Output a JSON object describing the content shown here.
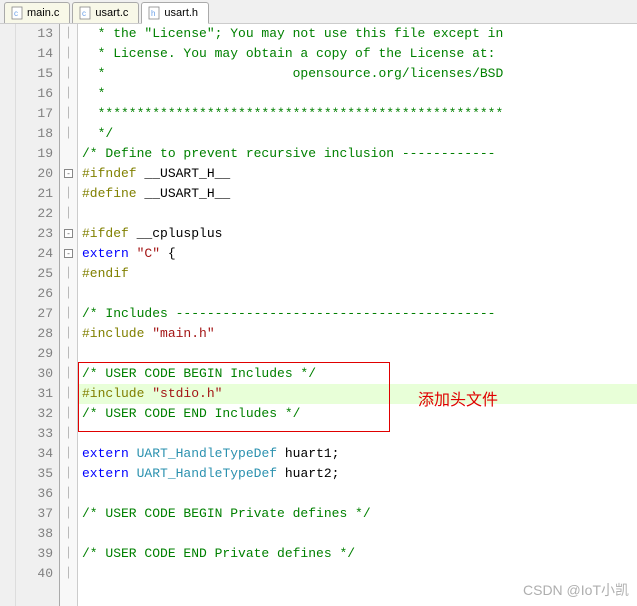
{
  "tabs": [
    {
      "label": "main.c",
      "active": false
    },
    {
      "label": "usart.c",
      "active": false
    },
    {
      "label": "usart.h",
      "active": true
    }
  ],
  "gutter_start": 13,
  "code_lines": [
    {
      "n": 13,
      "fold": "|",
      "segs": [
        {
          "cls": "c-comment",
          "t": "  * the \"License\"; You may not use this file except in"
        }
      ]
    },
    {
      "n": 14,
      "fold": "|",
      "segs": [
        {
          "cls": "c-comment",
          "t": "  * License. You may obtain a copy of the License at:"
        }
      ]
    },
    {
      "n": 15,
      "fold": "|",
      "segs": [
        {
          "cls": "c-comment",
          "t": "  *                        opensource.org/licenses/BSD"
        }
      ]
    },
    {
      "n": 16,
      "fold": "|",
      "segs": [
        {
          "cls": "c-comment",
          "t": "  *"
        }
      ]
    },
    {
      "n": 17,
      "fold": "|",
      "segs": [
        {
          "cls": "c-comment",
          "t": "  ****************************************************"
        }
      ]
    },
    {
      "n": 18,
      "fold": "|",
      "segs": [
        {
          "cls": "c-comment",
          "t": "  */"
        }
      ]
    },
    {
      "n": 19,
      "fold": "",
      "segs": [
        {
          "cls": "c-comment",
          "t": "/* Define to prevent recursive inclusion ------------"
        }
      ]
    },
    {
      "n": 20,
      "fold": "box-",
      "segs": [
        {
          "cls": "c-pp",
          "t": "#ifndef "
        },
        {
          "cls": "c-ident",
          "t": "__USART_H__"
        }
      ]
    },
    {
      "n": 21,
      "fold": "|",
      "segs": [
        {
          "cls": "c-pp",
          "t": "#define "
        },
        {
          "cls": "c-ident",
          "t": "__USART_H__"
        }
      ]
    },
    {
      "n": 22,
      "fold": "|",
      "segs": []
    },
    {
      "n": 23,
      "fold": "box-",
      "segs": [
        {
          "cls": "c-pp",
          "t": "#ifdef "
        },
        {
          "cls": "c-ident",
          "t": "__cplusplus"
        }
      ]
    },
    {
      "n": 24,
      "fold": "box-",
      "segs": [
        {
          "cls": "c-keyword",
          "t": "extern"
        },
        {
          "cls": "c-ident",
          "t": " "
        },
        {
          "cls": "c-string",
          "t": "\"C\""
        },
        {
          "cls": "c-ident",
          "t": " {"
        }
      ]
    },
    {
      "n": 25,
      "fold": "|",
      "segs": [
        {
          "cls": "c-pp",
          "t": "#endif"
        }
      ]
    },
    {
      "n": 26,
      "fold": "|",
      "segs": []
    },
    {
      "n": 27,
      "fold": "|",
      "segs": [
        {
          "cls": "c-comment",
          "t": "/* Includes -----------------------------------------"
        }
      ]
    },
    {
      "n": 28,
      "fold": "|",
      "segs": [
        {
          "cls": "c-pp",
          "t": "#include "
        },
        {
          "cls": "c-string",
          "t": "\"main.h\""
        }
      ]
    },
    {
      "n": 29,
      "fold": "|",
      "segs": []
    },
    {
      "n": 30,
      "fold": "|",
      "segs": [
        {
          "cls": "c-comment",
          "t": "/* USER CODE BEGIN Includes */"
        }
      ]
    },
    {
      "n": 31,
      "fold": "|",
      "hl": true,
      "segs": [
        {
          "cls": "c-pp",
          "t": "#include "
        },
        {
          "cls": "c-string",
          "t": "\"stdio.h\""
        }
      ]
    },
    {
      "n": 32,
      "fold": "|",
      "segs": [
        {
          "cls": "c-comment",
          "t": "/* USER CODE END Includes */"
        }
      ]
    },
    {
      "n": 33,
      "fold": "|",
      "segs": []
    },
    {
      "n": 34,
      "fold": "|",
      "segs": [
        {
          "cls": "c-keyword",
          "t": "extern"
        },
        {
          "cls": "c-ident",
          "t": " "
        },
        {
          "cls": "c-type",
          "t": "UART_HandleTypeDef"
        },
        {
          "cls": "c-ident",
          "t": " huart1;"
        }
      ]
    },
    {
      "n": 35,
      "fold": "|",
      "segs": [
        {
          "cls": "c-keyword",
          "t": "extern"
        },
        {
          "cls": "c-ident",
          "t": " "
        },
        {
          "cls": "c-type",
          "t": "UART_HandleTypeDef"
        },
        {
          "cls": "c-ident",
          "t": " huart2;"
        }
      ]
    },
    {
      "n": 36,
      "fold": "|",
      "segs": []
    },
    {
      "n": 37,
      "fold": "|",
      "segs": [
        {
          "cls": "c-comment",
          "t": "/* USER CODE BEGIN Private defines */"
        }
      ]
    },
    {
      "n": 38,
      "fold": "|",
      "segs": []
    },
    {
      "n": 39,
      "fold": "|",
      "segs": [
        {
          "cls": "c-comment",
          "t": "/* USER CODE END Private defines */"
        }
      ]
    },
    {
      "n": 40,
      "fold": "|",
      "segs": []
    }
  ],
  "annotation": "添加头文件",
  "watermark": "CSDN @IoT小凯",
  "icon_colors": {
    "c": "#6aa0e8",
    "h": "#6aa0e8"
  }
}
